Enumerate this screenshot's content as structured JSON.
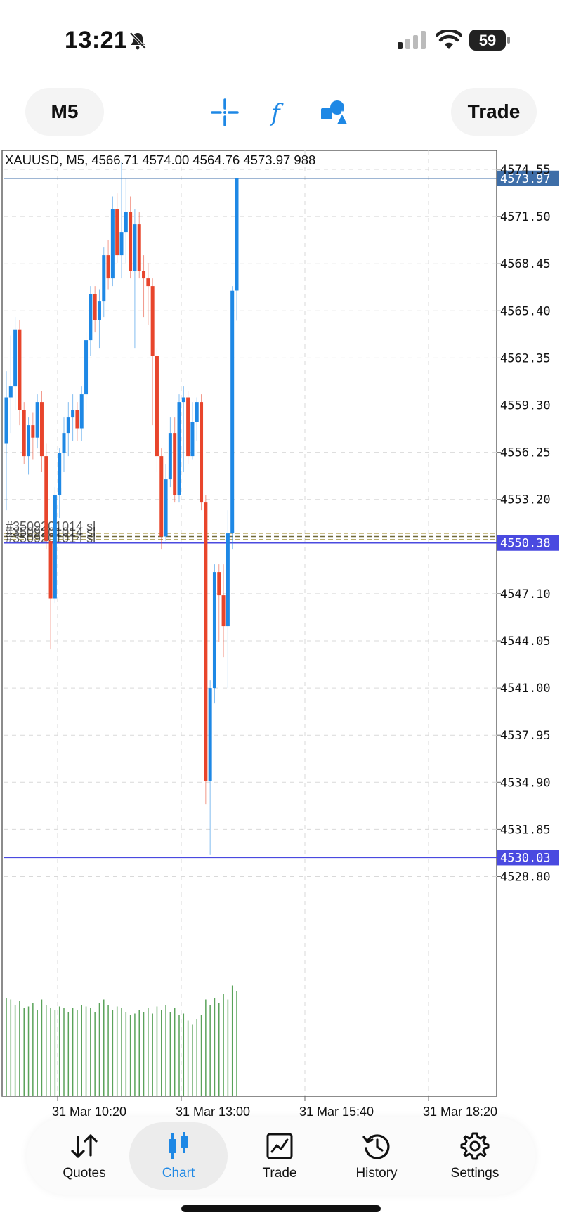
{
  "status_bar": {
    "time": "13:21",
    "battery": "59"
  },
  "toolbar": {
    "timeframe": "M5",
    "trade_label": "Trade"
  },
  "chart_data": {
    "type": "candlestick",
    "title": "XAUUSD, M5, 4566.71 4574.00 4564.76 4573.97 988",
    "symbol": "XAUUSD",
    "timeframe": "M5",
    "ohlc_label": "4566.71 4574.00 4564.76 4573.97 988",
    "ylim": [
      4526.0,
      4576.0
    ],
    "y_ticks": [
      "4574.55",
      "4571.50",
      "4568.45",
      "4565.40",
      "4562.35",
      "4559.30",
      "4556.25",
      "4553.20",
      "4547.10",
      "4544.05",
      "4541.00",
      "4537.95",
      "4534.90",
      "4531.85",
      "4528.80"
    ],
    "x_ticks": [
      "31 Mar 10:20",
      "31 Mar 13:00",
      "31 Mar 15:40",
      "31 Mar 18:20"
    ],
    "price_labels": [
      {
        "text": "4573.97",
        "value": 4573.97,
        "color": "#3e6ea8"
      },
      {
        "text": "4550.38",
        "value": 4550.38,
        "color": "#4a4ae0"
      },
      {
        "text": "4530.03",
        "value": 4530.03,
        "color": "#4a4ae0"
      }
    ],
    "order_label": "#3509201014 sl",
    "order_levels": [
      4551.0,
      4550.8,
      4550.6
    ],
    "colors": {
      "bull": "#1e88e5",
      "bear": "#e8452c",
      "volume": "#5aa35a",
      "grid": "#d9d9d9"
    },
    "candles": [
      {
        "o": 4556.8,
        "h": 4561.5,
        "l": 4552.5,
        "c": 4559.8
      },
      {
        "o": 4559.8,
        "h": 4563.8,
        "l": 4557.5,
        "c": 4560.5
      },
      {
        "o": 4560.5,
        "h": 4565.0,
        "l": 4559.0,
        "c": 4564.2
      },
      {
        "o": 4564.2,
        "h": 4564.8,
        "l": 4558.0,
        "c": 4559.0
      },
      {
        "o": 4559.0,
        "h": 4559.5,
        "l": 4555.5,
        "c": 4556.0
      },
      {
        "o": 4556.0,
        "h": 4558.5,
        "l": 4554.8,
        "c": 4558.0
      },
      {
        "o": 4558.0,
        "h": 4558.8,
        "l": 4555.8,
        "c": 4557.2
      },
      {
        "o": 4557.2,
        "h": 4560.0,
        "l": 4556.5,
        "c": 4559.5
      },
      {
        "o": 4559.5,
        "h": 4560.2,
        "l": 4555.0,
        "c": 4556.0
      },
      {
        "o": 4556.0,
        "h": 4556.8,
        "l": 4550.0,
        "c": 4550.5
      },
      {
        "o": 4550.5,
        "h": 4551.0,
        "l": 4543.5,
        "c": 4546.8
      },
      {
        "o": 4546.8,
        "h": 4554.0,
        "l": 4546.5,
        "c": 4553.5
      },
      {
        "o": 4553.5,
        "h": 4556.5,
        "l": 4552.0,
        "c": 4556.2
      },
      {
        "o": 4556.2,
        "h": 4558.5,
        "l": 4555.0,
        "c": 4557.5
      },
      {
        "o": 4557.5,
        "h": 4559.5,
        "l": 4556.0,
        "c": 4558.5
      },
      {
        "o": 4558.5,
        "h": 4560.0,
        "l": 4557.0,
        "c": 4559.0
      },
      {
        "o": 4559.0,
        "h": 4559.5,
        "l": 4557.0,
        "c": 4557.8
      },
      {
        "o": 4557.8,
        "h": 4560.5,
        "l": 4557.0,
        "c": 4560.0
      },
      {
        "o": 4560.0,
        "h": 4564.0,
        "l": 4559.0,
        "c": 4563.5
      },
      {
        "o": 4563.5,
        "h": 4567.0,
        "l": 4562.5,
        "c": 4566.5
      },
      {
        "o": 4566.5,
        "h": 4567.0,
        "l": 4564.0,
        "c": 4564.8
      },
      {
        "o": 4564.8,
        "h": 4566.8,
        "l": 4563.0,
        "c": 4566.0
      },
      {
        "o": 4566.0,
        "h": 4569.5,
        "l": 4565.0,
        "c": 4569.0
      },
      {
        "o": 4569.0,
        "h": 4570.0,
        "l": 4566.8,
        "c": 4567.5
      },
      {
        "o": 4567.5,
        "h": 4572.8,
        "l": 4567.0,
        "c": 4572.0
      },
      {
        "o": 4572.0,
        "h": 4573.0,
        "l": 4568.5,
        "c": 4569.0
      },
      {
        "o": 4569.0,
        "h": 4575.0,
        "l": 4567.5,
        "c": 4570.5
      },
      {
        "o": 4570.5,
        "h": 4574.0,
        "l": 4568.5,
        "c": 4571.8
      },
      {
        "o": 4571.8,
        "h": 4572.8,
        "l": 4567.5,
        "c": 4568.0
      },
      {
        "o": 4568.0,
        "h": 4572.0,
        "l": 4563.0,
        "c": 4571.0
      },
      {
        "o": 4571.0,
        "h": 4571.8,
        "l": 4567.5,
        "c": 4568.0
      },
      {
        "o": 4568.0,
        "h": 4569.0,
        "l": 4565.0,
        "c": 4567.5
      },
      {
        "o": 4567.5,
        "h": 4568.5,
        "l": 4564.5,
        "c": 4567.0
      },
      {
        "o": 4567.0,
        "h": 4567.5,
        "l": 4558.0,
        "c": 4562.5
      },
      {
        "o": 4562.5,
        "h": 4563.0,
        "l": 4555.0,
        "c": 4556.0
      },
      {
        "o": 4556.0,
        "h": 4556.5,
        "l": 4550.0,
        "c": 4550.8
      },
      {
        "o": 4550.8,
        "h": 4555.5,
        "l": 4550.5,
        "c": 4554.5
      },
      {
        "o": 4554.5,
        "h": 4558.5,
        "l": 4554.0,
        "c": 4557.5
      },
      {
        "o": 4557.5,
        "h": 4558.5,
        "l": 4553.0,
        "c": 4553.5
      },
      {
        "o": 4553.5,
        "h": 4560.0,
        "l": 4553.0,
        "c": 4559.5
      },
      {
        "o": 4559.5,
        "h": 4560.5,
        "l": 4555.0,
        "c": 4559.8
      },
      {
        "o": 4559.8,
        "h": 4560.2,
        "l": 4555.5,
        "c": 4556.0
      },
      {
        "o": 4556.0,
        "h": 4559.5,
        "l": 4555.8,
        "c": 4558.2
      },
      {
        "o": 4558.2,
        "h": 4559.8,
        "l": 4557.0,
        "c": 4559.5
      },
      {
        "o": 4559.5,
        "h": 4560.0,
        "l": 4552.5,
        "c": 4553.0
      },
      {
        "o": 4553.0,
        "h": 4553.5,
        "l": 4533.5,
        "c": 4535.0
      },
      {
        "o": 4535.0,
        "h": 4541.5,
        "l": 4530.2,
        "c": 4541.0
      },
      {
        "o": 4541.0,
        "h": 4549.0,
        "l": 4540.0,
        "c": 4548.5
      },
      {
        "o": 4548.5,
        "h": 4549.0,
        "l": 4544.0,
        "c": 4547.0
      },
      {
        "o": 4547.0,
        "h": 4549.0,
        "l": 4543.0,
        "c": 4545.0
      },
      {
        "o": 4545.0,
        "h": 4552.5,
        "l": 4541.0,
        "c": 4551.0
      },
      {
        "o": 4551.0,
        "h": 4567.0,
        "l": 4550.0,
        "c": 4566.7
      },
      {
        "o": 4566.71,
        "h": 4574.0,
        "l": 4564.76,
        "c": 4573.97
      }
    ],
    "volume": [
      0.56,
      0.55,
      0.52,
      0.54,
      0.5,
      0.51,
      0.53,
      0.49,
      0.55,
      0.52,
      0.5,
      0.49,
      0.51,
      0.5,
      0.48,
      0.5,
      0.49,
      0.52,
      0.51,
      0.5,
      0.48,
      0.53,
      0.55,
      0.52,
      0.49,
      0.51,
      0.5,
      0.48,
      0.46,
      0.47,
      0.49,
      0.48,
      0.5,
      0.47,
      0.51,
      0.49,
      0.52,
      0.48,
      0.5,
      0.46,
      0.47,
      0.43,
      0.41,
      0.44,
      0.46,
      0.55,
      0.52,
      0.56,
      0.53,
      0.58,
      0.55,
      0.63,
      0.6
    ]
  },
  "nav": {
    "items": [
      {
        "label": "Quotes"
      },
      {
        "label": "Chart"
      },
      {
        "label": "Trade"
      },
      {
        "label": "History"
      },
      {
        "label": "Settings"
      }
    ]
  }
}
